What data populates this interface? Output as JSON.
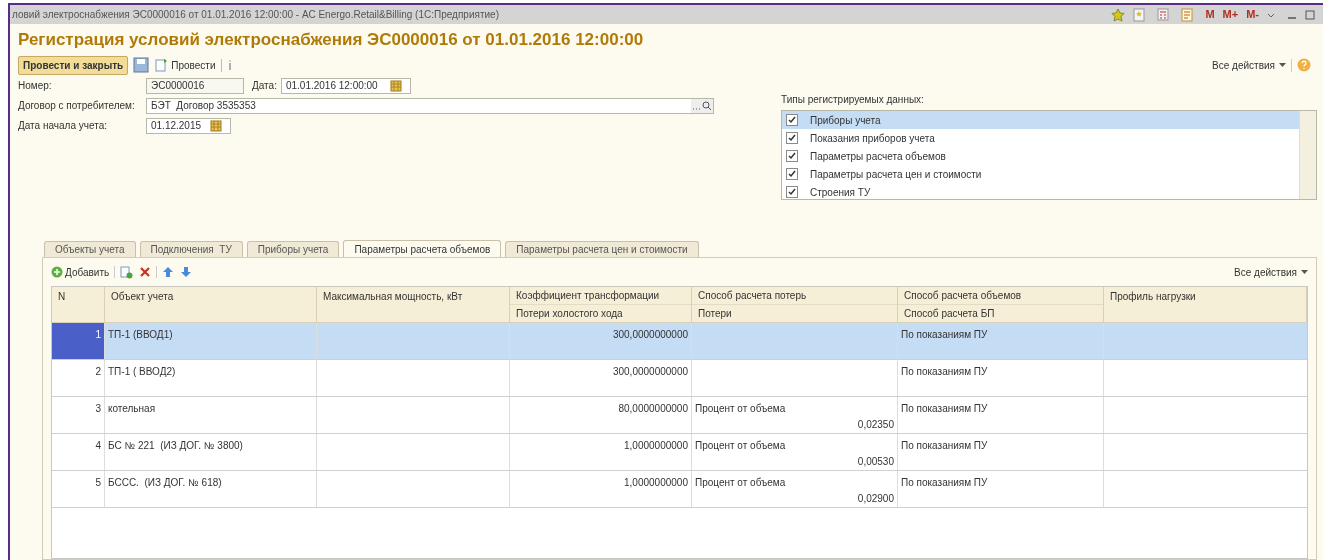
{
  "window": {
    "title": "ловий электроснабжения ЭС0000016 от 01.01.2016 12:00:00 - АС Energo.Retail&Billing  (1С:Предприятие)",
    "title_buttons": [
      "M",
      "M+",
      "M-"
    ]
  },
  "heading": "Регистрация условий электроснабжения ЭС0000016 от 01.01.2016 12:00:00",
  "toolbar": {
    "primary": "Провести и закрыть",
    "post": "Провести",
    "all_actions": "Все действия"
  },
  "fields": [
    {
      "label": "Номер:",
      "value": "ЭС0000016"
    },
    {
      "label": "Дата:",
      "value": "01.01.2016 12:00:00"
    },
    {
      "label": "Договор с потребителем:",
      "value": "БЭТ  Договор 3535353"
    },
    {
      "label": "Дата начала учета:",
      "value": "01.12.2015"
    }
  ],
  "data_types": {
    "label": "Типы регистрируемых данных:",
    "items": [
      {
        "label": "Приборы учета",
        "checked": true,
        "selected": true
      },
      {
        "label": "Показания приборов учета",
        "checked": true,
        "selected": false
      },
      {
        "label": "Параметры расчета объемов",
        "checked": true,
        "selected": false
      },
      {
        "label": "Параметры расчета цен и стоимости",
        "checked": true,
        "selected": false
      },
      {
        "label": "Строения ТУ",
        "checked": true,
        "selected": false
      }
    ]
  },
  "tabs": [
    {
      "label": "Объекты учета",
      "selected": false
    },
    {
      "label": "Подключения  ТУ",
      "selected": false
    },
    {
      "label": "Приборы учета",
      "selected": false
    },
    {
      "label": "Параметры расчета объемов",
      "selected": true
    },
    {
      "label": "Параметры расчета цен и стоимости",
      "selected": false
    }
  ],
  "table_toolbar": {
    "add": "Добавить",
    "all_actions": "Все действия"
  },
  "table": {
    "columns": [
      {
        "top": "N"
      },
      {
        "top": "Объект учета"
      },
      {
        "top": "Максимальная мощность, кВт"
      },
      {
        "top": "Коэффициент трансформации",
        "bottom": "Потери холостого хода"
      },
      {
        "top": "Способ расчета потерь",
        "bottom": "Потери"
      },
      {
        "top": "Способ расчета объемов",
        "bottom": "Способ расчета БП"
      },
      {
        "top": "Профиль нагрузки"
      }
    ],
    "rows": [
      {
        "n": "1",
        "object": "ТП-1 (ВВОД1)",
        "coefficient": "300,0000000000",
        "volume_method": "По показаниям ПУ",
        "selected": true
      },
      {
        "n": "2",
        "object": "ТП-1 ( ВВОД2)",
        "coefficient": "300,0000000000",
        "volume_method": "По показаниям ПУ",
        "selected": false
      },
      {
        "n": "3",
        "object": "котельная",
        "coefficient": "80,0000000000",
        "loss_method": "Процент от объема",
        "losses": "0,02350",
        "volume_method": "По показаниям ПУ",
        "selected": false
      },
      {
        "n": "4",
        "object": "БС № 221  (ИЗ ДОГ. № 3800)",
        "coefficient": "1,0000000000",
        "loss_method": "Процент от объема",
        "losses": "0,00530",
        "volume_method": "По показаниям ПУ",
        "selected": false
      },
      {
        "n": "5",
        "object": "БССС.  (ИЗ ДОГ. № 618)",
        "coefficient": "1,0000000000",
        "loss_method": "Процент от объема",
        "losses": "0,02900",
        "volume_method": "По показаниям ПУ",
        "selected": false
      }
    ]
  }
}
